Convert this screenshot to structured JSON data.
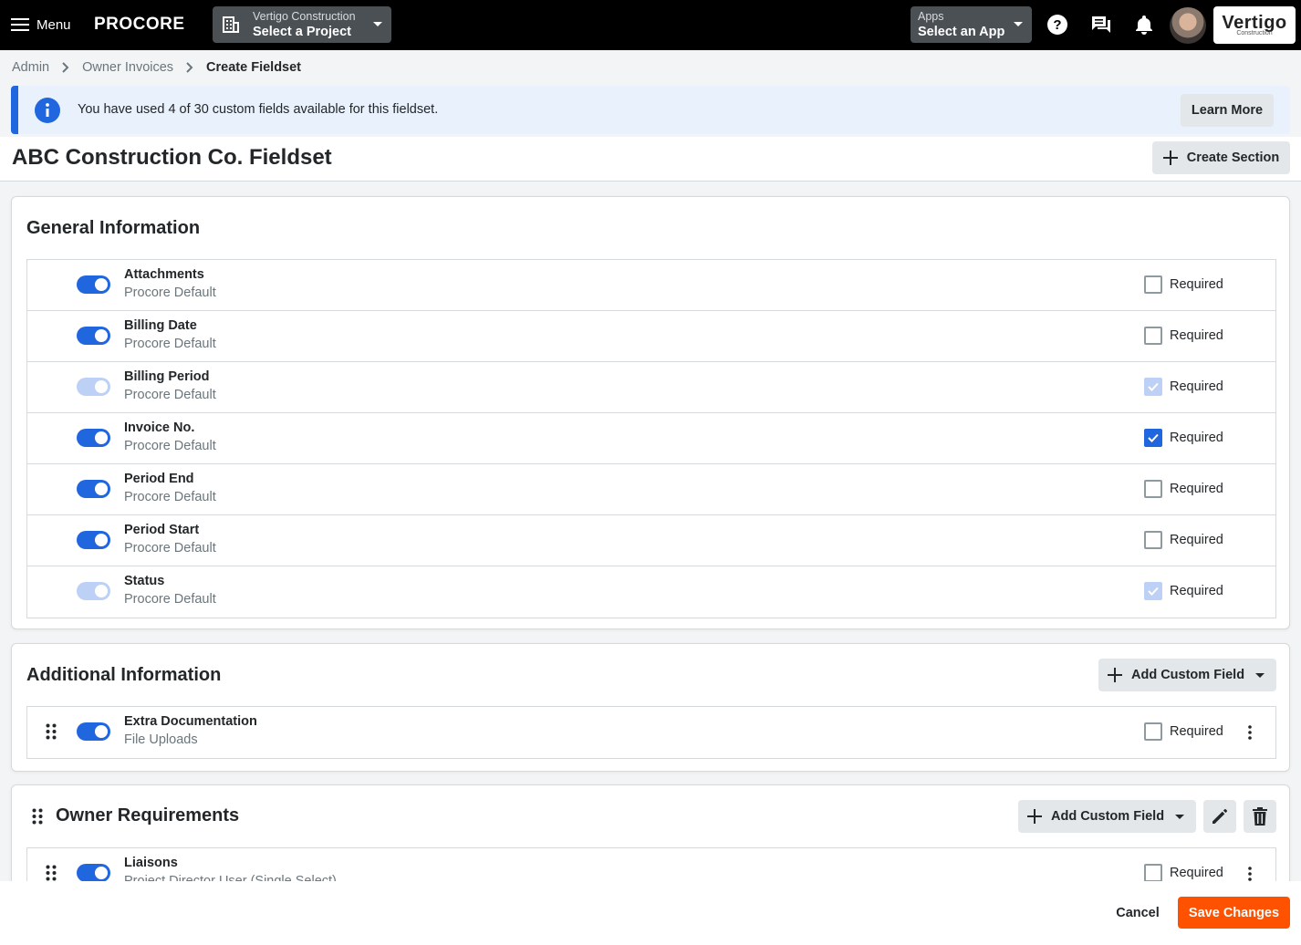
{
  "nav": {
    "menu_label": "Menu",
    "logo_text": "PROCORE",
    "project_company": "Vertigo Construction",
    "project_select": "Select a Project",
    "apps_label": "Apps",
    "apps_select": "Select an App",
    "company_logo_main": "Vertigo",
    "company_logo_sub": "Construction",
    "icons": [
      "menu-icon",
      "building-icon",
      "help-icon",
      "chat-icon",
      "bell-icon"
    ]
  },
  "breadcrumb": [
    "Admin",
    "Owner Invoices",
    "Create Fieldset"
  ],
  "banner": {
    "message": "You have used 4 of 30 custom fields available for this fieldset.",
    "learn_more": "Learn More"
  },
  "page": {
    "title": "ABC Construction Co. Fieldset",
    "create_section": "Create Section"
  },
  "sections": {
    "general": {
      "title": "General Information",
      "fields": [
        {
          "name": "Attachments",
          "sub": "Procore Default",
          "enabled": true,
          "toggle_disabled": false,
          "required": false,
          "required_disabled": false
        },
        {
          "name": "Billing Date",
          "sub": "Procore Default",
          "enabled": true,
          "toggle_disabled": false,
          "required": false,
          "required_disabled": false
        },
        {
          "name": "Billing Period",
          "sub": "Procore Default",
          "enabled": true,
          "toggle_disabled": true,
          "required": true,
          "required_disabled": true
        },
        {
          "name": "Invoice No.",
          "sub": "Procore Default",
          "enabled": true,
          "toggle_disabled": false,
          "required": true,
          "required_disabled": false
        },
        {
          "name": "Period End",
          "sub": "Procore Default",
          "enabled": true,
          "toggle_disabled": false,
          "required": false,
          "required_disabled": false
        },
        {
          "name": "Period Start",
          "sub": "Procore Default",
          "enabled": true,
          "toggle_disabled": false,
          "required": false,
          "required_disabled": false
        },
        {
          "name": "Status",
          "sub": "Procore Default",
          "enabled": true,
          "toggle_disabled": true,
          "required": true,
          "required_disabled": true
        }
      ]
    },
    "additional": {
      "title": "Additional Information",
      "add_button": "Add Custom Field",
      "fields": [
        {
          "name": "Extra Documentation",
          "sub": "File Uploads",
          "enabled": true,
          "required": false
        }
      ]
    },
    "owner": {
      "title": "Owner Requirements",
      "add_button": "Add Custom Field",
      "fields": [
        {
          "name": "Liaisons",
          "sub": "Project Director User (Single Select)",
          "enabled": true,
          "required": false
        }
      ]
    }
  },
  "required_label": "Required",
  "footer": {
    "cancel": "Cancel",
    "save": "Save Changes"
  },
  "colors": {
    "primary_blue": "#2066df",
    "disabled_blue": "#bcd1f5",
    "save_orange": "#ff5200",
    "nav_bg": "#000000"
  }
}
